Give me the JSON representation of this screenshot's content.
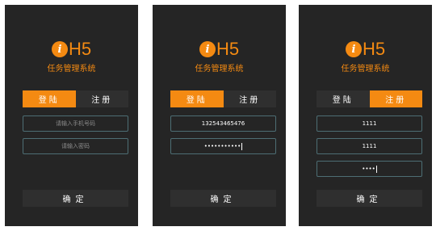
{
  "app": {
    "logo_mark": "i",
    "logo_text": "H5",
    "subtitle": "任务管理系统",
    "accent": "#f48a12"
  },
  "screens": [
    {
      "tabs": [
        {
          "label": "登陆",
          "active": true
        },
        {
          "label": "注册",
          "active": false
        }
      ],
      "fields": [
        {
          "placeholder": "请输入手机号码",
          "value": ""
        },
        {
          "placeholder": "请输入密码",
          "value": ""
        }
      ],
      "confirm_label": "确定"
    },
    {
      "tabs": [
        {
          "label": "登陆",
          "active": true
        },
        {
          "label": "注册",
          "active": false
        }
      ],
      "fields": [
        {
          "placeholder": "请输入手机号码",
          "value": "132543465476"
        },
        {
          "placeholder": "请输入密码",
          "value": "•••••••••••"
        }
      ],
      "confirm_label": "确定"
    },
    {
      "tabs": [
        {
          "label": "登陆",
          "active": false
        },
        {
          "label": "注册",
          "active": true
        }
      ],
      "fields": [
        {
          "value": "1111"
        },
        {
          "value": "1111"
        },
        {
          "value": "••••"
        }
      ],
      "confirm_label": "确定"
    }
  ]
}
